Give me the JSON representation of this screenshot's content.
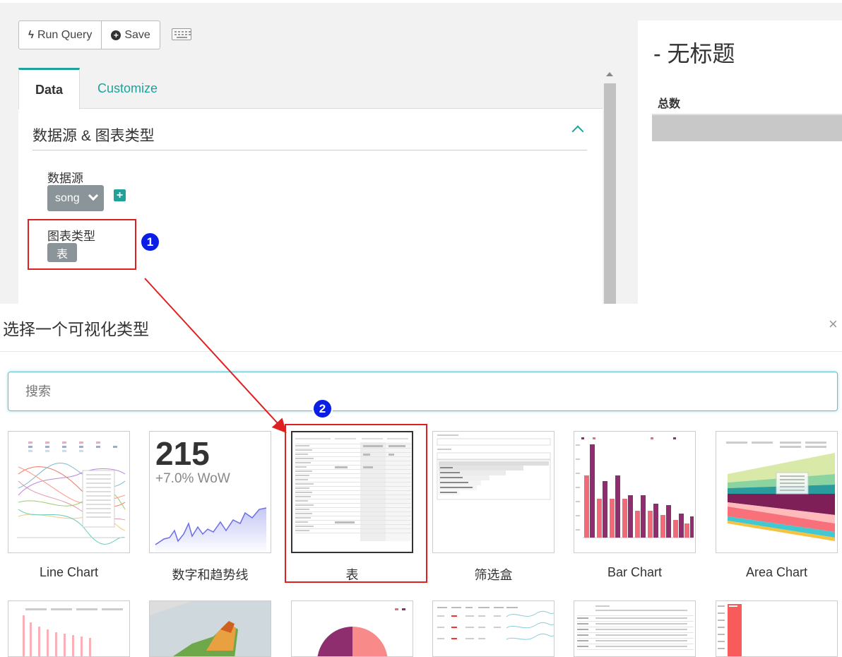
{
  "toolbar": {
    "run_query_label": "Run Query",
    "save_label": "Save"
  },
  "tabs": [
    {
      "label": "Data",
      "active": true
    },
    {
      "label": "Customize",
      "active": false
    }
  ],
  "section": {
    "title": "数据源 & 图表类型",
    "datasource_label": "数据源",
    "datasource_value": "song",
    "charttype_label": "图表类型",
    "charttype_value": "表"
  },
  "preview": {
    "title": "- 无标题",
    "column_header": "总数"
  },
  "annotations": {
    "step1": "1",
    "step2": "2"
  },
  "modal": {
    "title": "选择一个可视化类型",
    "close": "×",
    "search_placeholder": "搜索",
    "big_number": {
      "value": "215",
      "delta": "+7.0% WoW"
    },
    "cards": [
      {
        "label": "Line Chart",
        "icon": "line-chart-thumb"
      },
      {
        "label": "数字和趋势线",
        "icon": "big-number-trendline-thumb"
      },
      {
        "label": "表",
        "icon": "table-thumb",
        "selected": true
      },
      {
        "label": "筛选盒",
        "icon": "filter-box-thumb"
      },
      {
        "label": "Bar Chart",
        "icon": "bar-chart-thumb"
      },
      {
        "label": "Area Chart",
        "icon": "area-chart-thumb"
      }
    ]
  },
  "colors": {
    "accent": "#20a29a",
    "highlight": "#e02020",
    "step_badge": "#0a1ee6",
    "select_bg": "#8b9499"
  }
}
